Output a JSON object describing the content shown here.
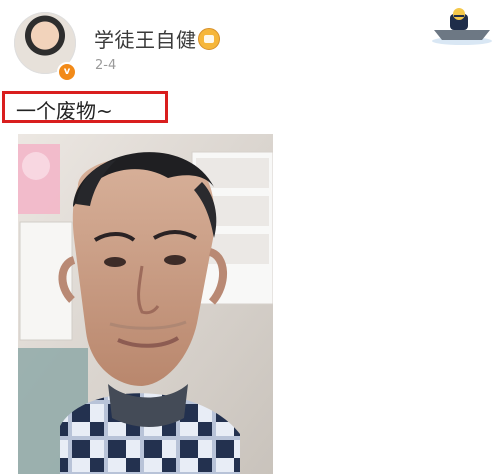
{
  "post": {
    "author_name": "学徒王自健",
    "time": "2-4",
    "text": "一个废物~",
    "badge_icon": "verified-badge-icon",
    "vip_icon": "vip-emoji-icon"
  },
  "photo": {
    "description_icon": "selfie-photo",
    "watermark": ""
  },
  "decoration": {
    "corner_icon": "boat-character-icon"
  },
  "colors": {
    "highlight_border": "#d91e1e",
    "badge": "#f28a18"
  }
}
